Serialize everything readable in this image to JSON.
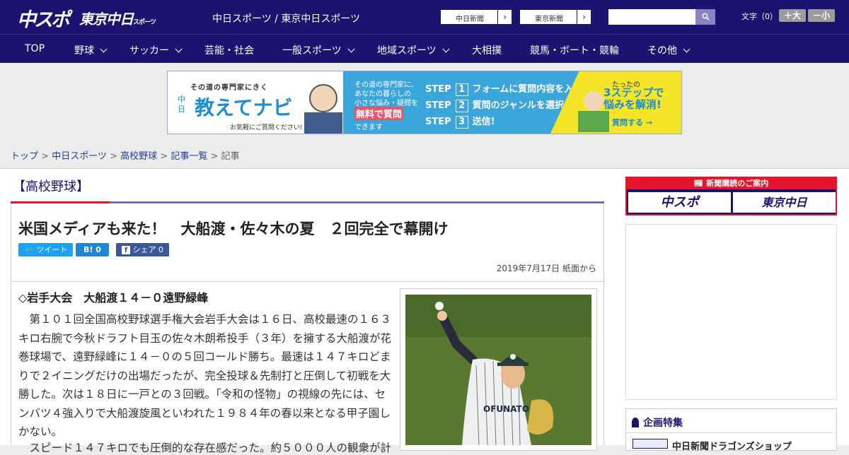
{
  "header": {
    "logo_chuspo": "中スポ",
    "logo_tokyo": "東京中日",
    "logo_tokyo_small": "スポーツ",
    "site_title": "中日スポーツ / 東京中日スポーツ",
    "ext_links": [
      "中日新聞",
      "東京新聞"
    ],
    "search_placeholder": "",
    "font_size_label": "文字（0）",
    "font_bigger": "＋大",
    "font_smaller": "－小"
  },
  "nav": {
    "items": [
      {
        "label": "TOP",
        "dropdown": false
      },
      {
        "label": "野球",
        "dropdown": true
      },
      {
        "label": "サッカー",
        "dropdown": true
      },
      {
        "label": "芸能・社会",
        "dropdown": false
      },
      {
        "label": "一般スポーツ",
        "dropdown": true
      },
      {
        "label": "地域スポーツ",
        "dropdown": true
      },
      {
        "label": "大相撲",
        "dropdown": false
      },
      {
        "label": "競馬・ボート・競輪",
        "dropdown": false
      },
      {
        "label": "その他",
        "dropdown": true
      }
    ]
  },
  "banner": {
    "tagline": "その道の専門家にきく",
    "side": "中日",
    "title": "教えてナビ",
    "note": "お気軽にご質問ください!",
    "desc1": "その道の専門家に、",
    "desc2": "あなたの暮らしの",
    "desc3": "小さな悩み・疑問を",
    "free": "無料で質問",
    "desc4": "できます",
    "step1": "フォームに質問内容を入力",
    "step2": "質問のジャンルを選択",
    "step3": "送信!",
    "step_word": "STEP",
    "right1": "たったの",
    "right2": "3ステップで",
    "right3": "悩みを解消!",
    "right_btn": "質問する →"
  },
  "breadcrumb": {
    "items": [
      "トップ",
      "中日スポーツ",
      "高校野球",
      "記事一覧"
    ],
    "current": "記事",
    "sep": ">"
  },
  "article": {
    "category": "【高校野球】",
    "headline": "米国メディアも来た！　大船渡・佐々木の夏　２回完全で幕開け",
    "tweet": "ツイート",
    "hatena": "B! 0",
    "share": "シェア 0",
    "date": "2019年7月17日 紙面から",
    "subhead": "◇岩手大会　大船渡１４－０遠野緑峰",
    "paragraph1": "第１０１回全国高校野球選手権大会岩手大会は１６日、高校最速の１６３キロ右腕で今秋ドラフト目玉の佐々木朗希投手（３年）を擁する大船渡が花巻球場で、遠野緑峰に１４－０の５回コールド勝ち。最速は１４７キロどまりで２イニングだけの出場だったが、完全投球＆先制打と圧倒して初戦を大勝した。次は１８日に一戸との３回戦。「令和の怪物」の視線の先には、センバツ４強入りで大船渡旋風といわれた１９８４年の春以来となる甲子園しかない。",
    "paragraph2": "スピード１４７キロでも圧倒的な存在感だった。約５０００人の観衆が計",
    "photo_text": "OFUNATO"
  },
  "sidebar": {
    "ad_title": "新聞購読のご案内",
    "logo1": "中スポ",
    "logo2": "東京中日",
    "feature_title": "企画特集",
    "feature_item": "中日新聞ドラゴンズショップ"
  }
}
